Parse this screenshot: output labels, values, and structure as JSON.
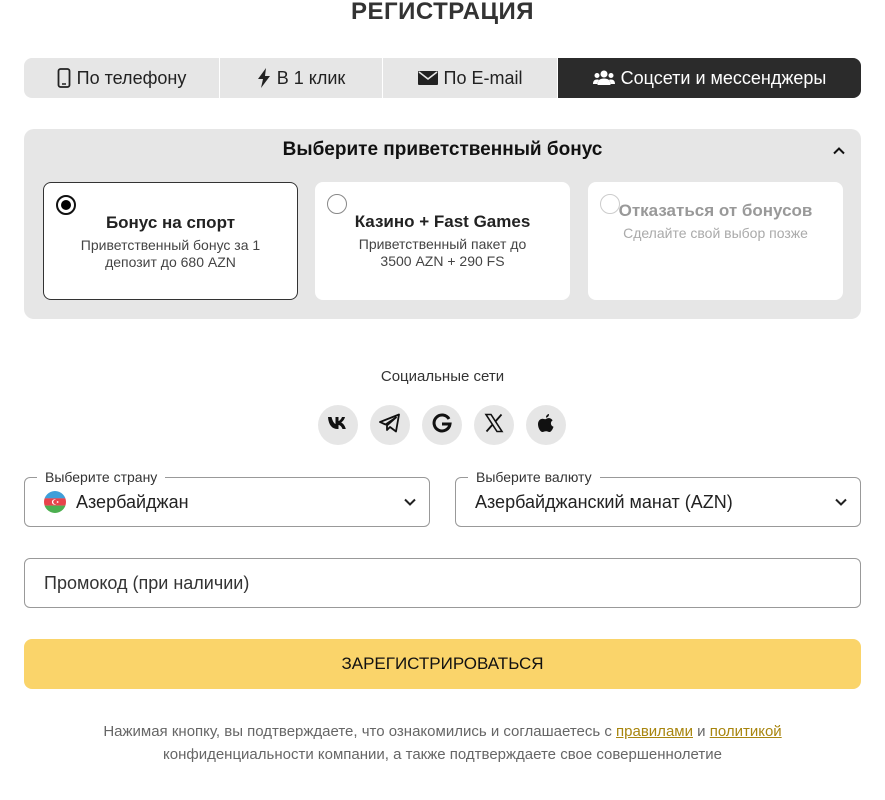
{
  "page": {
    "title": "РЕГИСТРАЦИЯ"
  },
  "tabs": [
    {
      "label": "По телефону",
      "icon": "phone-icon",
      "active": false
    },
    {
      "label": "В 1 клик",
      "icon": "lightning-icon",
      "active": false
    },
    {
      "label": "По E-mail",
      "icon": "envelope-icon",
      "active": false
    },
    {
      "label": "Соцсети и мессенджеры",
      "icon": "users-icon",
      "active": true
    }
  ],
  "bonus": {
    "title": "Выберите приветственный бонус",
    "options": [
      {
        "title": "Бонус на спорт",
        "desc": "Приветственный бонус за 1 депозит до 680 AZN",
        "selected": true
      },
      {
        "title": "Казино + Fast Games",
        "desc": "Приветственный пакет до 3500 AZN + 290 FS",
        "selected": false
      },
      {
        "title": "Отказаться от бонусов",
        "desc": "Сделайте свой выбор позже",
        "selected": false
      }
    ]
  },
  "social": {
    "label": "Социальные сети",
    "networks": [
      {
        "name": "vk-icon",
        "glyph": "vk"
      },
      {
        "name": "telegram-icon"
      },
      {
        "name": "google-icon",
        "glyph": "G"
      },
      {
        "name": "x-icon",
        "glyph": "X"
      },
      {
        "name": "apple-icon"
      }
    ]
  },
  "country": {
    "legend": "Выберите страну",
    "value": "Азербайджан",
    "flag": "azerbaijan-flag-icon"
  },
  "currency": {
    "legend": "Выберите валюту",
    "value": "Азербайджанский манат (AZN)"
  },
  "promo": {
    "placeholder": "Промокод (при наличии)",
    "value": ""
  },
  "submit": {
    "label": "ЗАРЕГИСТРИРОВАТЬСЯ"
  },
  "legal": {
    "text_before": "Нажимая кнопку, вы подтверждаете, что ознакомились и соглашаетесь с ",
    "rules_link": "правилами",
    "and": " и ",
    "policy_link": "политикой",
    "text_after": " конфиденциальности компании, а также подтверждаете свое совершеннолетие"
  },
  "colors": {
    "accent_button": "#fad46a",
    "active_tab": "#2b2b2b",
    "panel_bg": "#e6e6e6",
    "link": "#a8850e"
  }
}
